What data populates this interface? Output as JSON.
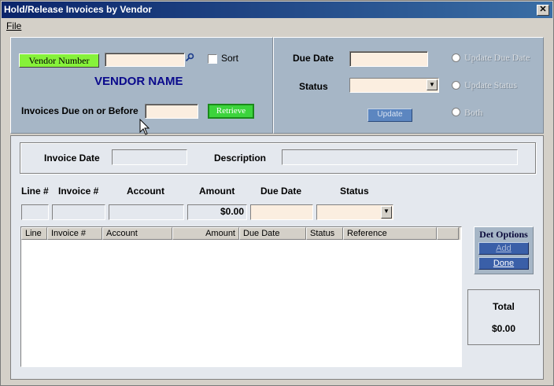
{
  "window": {
    "title": "Hold/Release Invoices by Vendor",
    "close_glyph": "✕"
  },
  "menu": {
    "file": "File"
  },
  "vendor": {
    "button": "Vendor Number",
    "search_icon": "magnifier-icon",
    "sort_label": "Sort",
    "vendor_name": "VENDOR NAME",
    "due_before_label": "Invoices Due on or Before",
    "retrieve": "Retrieve"
  },
  "update_panel": {
    "due_date_label": "Due Date",
    "status_label": "Status",
    "update_button": "Update",
    "options": [
      "Update Due Date",
      "Update Status",
      "Both"
    ]
  },
  "filter": {
    "invoice_date_label": "Invoice Date",
    "description_label": "Description"
  },
  "entry": {
    "columns": [
      "Line #",
      "Invoice #",
      "Account",
      "Amount",
      "Due Date",
      "Status"
    ],
    "amount_value": "$0.00"
  },
  "grid": {
    "columns": [
      "Line",
      "Invoice #",
      "Account",
      "Amount",
      "Due Date",
      "Status",
      "Reference"
    ],
    "rows": []
  },
  "det_options": {
    "title": "Det Options",
    "add": "Add",
    "done": "Done"
  },
  "total": {
    "label": "Total",
    "value": "$0.00"
  },
  "colors": {
    "title_bar": "#0a246a",
    "panel": "#a6b6c6",
    "vendor_button": "#86f23a",
    "retrieve_button": "#3cd43c",
    "vendor_name": "#0a0a8c"
  }
}
